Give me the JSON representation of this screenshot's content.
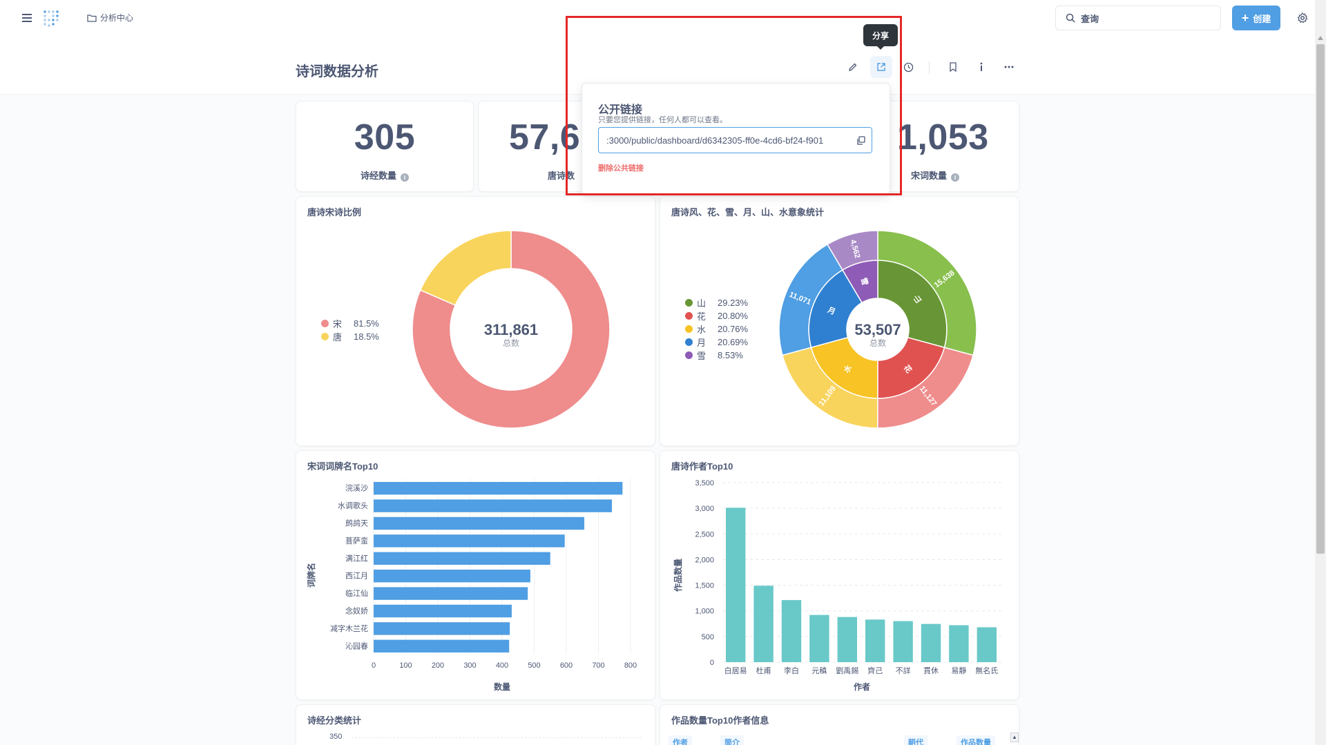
{
  "topbar": {
    "breadcrumb": "分析中心",
    "search_placeholder": "查询",
    "new_label": "创建"
  },
  "page": {
    "title": "诗词数据分析"
  },
  "tooltip": {
    "text": "分享"
  },
  "share_popover": {
    "title": "公开链接",
    "subtitle": "只要您提供链接，任何人都可以查看。",
    "link_value": ":3000/public/dashboard/d6342305-ff0e-4cd6-bf24-f901",
    "remove_label": "删除公共链接"
  },
  "scalars": [
    {
      "value": "305",
      "label": "诗经数量"
    },
    {
      "value": "57,6",
      "label": "唐诗数"
    },
    {
      "value": "1,053",
      "label": "宋词数量"
    }
  ],
  "cards": {
    "ratio_title": "唐诗宋诗比例",
    "imagery_title": "唐诗风、花、雪、月、山、水意象统计",
    "ci_title": "宋词词牌名Top10",
    "author_title": "唐诗作者Top10",
    "shijing_title": "诗经分类统计",
    "table_title": "作品数量Top10作者信息"
  },
  "table": {
    "headers": [
      "作者",
      "简介",
      "朝代",
      "作品数量"
    ]
  },
  "shijing_ytick": "350",
  "chart_data": [
    {
      "type": "pie",
      "title": "唐诗宋诗比例",
      "center_value": "311,861",
      "center_label": "总数",
      "slices": [
        {
          "name": "宋",
          "percent": "81.5%",
          "value": 81.5,
          "color": "#ef8c8c"
        },
        {
          "name": "唐",
          "percent": "18.5%",
          "value": 18.5,
          "color": "#f9d45c"
        }
      ]
    },
    {
      "type": "pie",
      "title": "唐诗风、花、雪、月、山、水意象统计",
      "center_value": "53,507",
      "center_label": "总数",
      "slices": [
        {
          "name": "山",
          "percent": "29.23%",
          "value": 15638,
          "outer_label": "15,638",
          "inner_color": "#689636",
          "outer_color": "#88bf4d"
        },
        {
          "name": "花",
          "percent": "20.80%",
          "value": 11127,
          "outer_label": "11,127",
          "inner_color": "#e05250",
          "outer_color": "#ef8c8c"
        },
        {
          "name": "水",
          "percent": "20.76%",
          "value": 11109,
          "outer_label": "11,109",
          "inner_color": "#f7c325",
          "outer_color": "#f9d45c"
        },
        {
          "name": "月",
          "percent": "20.69%",
          "value": 11071,
          "outer_label": "11,071",
          "inner_color": "#2f80d1",
          "outer_color": "#509ee3"
        },
        {
          "name": "雪",
          "percent": "8.53%",
          "value": 4562,
          "outer_label": "4,562",
          "inner_color": "#8e5bb7",
          "outer_color": "#a989c5"
        }
      ]
    },
    {
      "type": "bar",
      "orientation": "horizontal",
      "title": "宋词词牌名Top10",
      "xlabel": "数量",
      "ylabel": "词牌名",
      "xlim": [
        0,
        800
      ],
      "xticks": [
        "0",
        "100",
        "200",
        "300",
        "400",
        "500",
        "600",
        "700",
        "800"
      ],
      "categories": [
        "浣溪沙",
        "水调歌头",
        "鹧鸪天",
        "菩萨蛮",
        "满江红",
        "西江月",
        "临江仙",
        "念奴娇",
        "减字木兰花",
        "沁园春"
      ],
      "values": [
        775,
        742,
        656,
        595,
        550,
        488,
        480,
        430,
        424,
        422
      ],
      "color": "#509ee3"
    },
    {
      "type": "bar",
      "title": "唐诗作者Top10",
      "xlabel": "作者",
      "ylabel": "作品数量",
      "ylim": [
        0,
        3500
      ],
      "yticks": [
        "0",
        "500",
        "1,000",
        "1,500",
        "2,000",
        "2,500",
        "3,000",
        "3,500"
      ],
      "categories": [
        "白居易",
        "杜甫",
        "李白",
        "元稹",
        "劉禹錫",
        "齊己",
        "不詳",
        "貫休",
        "易靜",
        "無名氏"
      ],
      "values": [
        3010,
        1490,
        1210,
        920,
        880,
        830,
        800,
        745,
        720,
        680
      ],
      "color": "#69c8c8"
    }
  ]
}
